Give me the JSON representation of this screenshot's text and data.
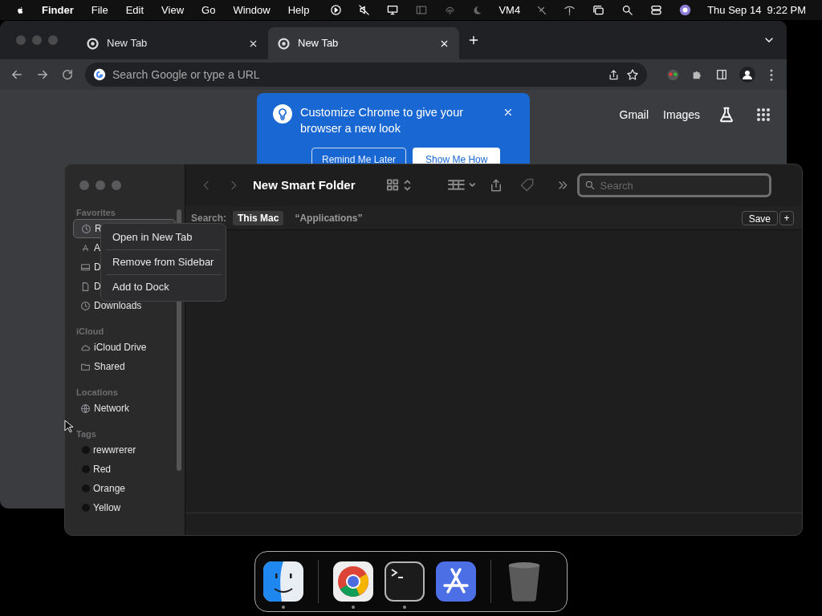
{
  "menu_bar": {
    "app": "Finder",
    "items": [
      "File",
      "Edit",
      "View",
      "Go",
      "Window",
      "Help"
    ],
    "status_text": "VM4",
    "clock": "Thu Sep 14  9:22 PM"
  },
  "browser": {
    "tabs": [
      {
        "label": "New Tab",
        "selected": false
      },
      {
        "label": "New Tab",
        "selected": true
      }
    ],
    "address_placeholder": "Search Google or type a URL",
    "promo": {
      "text": "Customize Chrome to give your browser a new look",
      "buttons": [
        "Remind Me Later",
        "Show Me How"
      ]
    },
    "links": [
      "Gmail",
      "Images"
    ]
  },
  "finder": {
    "title": "New Smart Folder",
    "search_placeholder": "Search",
    "scope_label": "Search:",
    "scopes": [
      {
        "label": "This Mac",
        "selected": true
      },
      {
        "label": "“Applications”",
        "selected": false
      }
    ],
    "save": "Save",
    "add": "+",
    "sidebar": [
      {
        "heading": "Favorites",
        "items": [
          {
            "label": "R",
            "selected": true
          },
          {
            "label": "A",
            "selected": false
          },
          {
            "label": "D",
            "selected": false
          },
          {
            "label": "D",
            "selected": false
          },
          {
            "label": "Downloads",
            "selected": false
          }
        ]
      },
      {
        "heading": "iCloud",
        "items": [
          {
            "label": "iCloud Drive",
            "selected": false
          },
          {
            "label": "Shared",
            "selected": false
          }
        ]
      },
      {
        "heading": "Locations",
        "items": [
          {
            "label": "Network",
            "selected": false
          }
        ]
      },
      {
        "heading": "Tags",
        "items": [
          {
            "label": "rewwrerer",
            "selected": false,
            "color": "#111111"
          },
          {
            "label": "Red",
            "selected": false,
            "color": "#111111"
          },
          {
            "label": "Orange",
            "selected": false,
            "color": "#111111"
          },
          {
            "label": "Yellow",
            "selected": false,
            "color": "#111111"
          }
        ]
      }
    ]
  },
  "context_menu": [
    "Open in New Tab",
    "Remove from Sidebar",
    "Add to Dock"
  ],
  "dock": [
    {
      "running": true
    },
    {
      "running": true
    },
    {
      "running": true
    },
    {
      "running": false
    },
    {
      "running": false
    }
  ]
}
